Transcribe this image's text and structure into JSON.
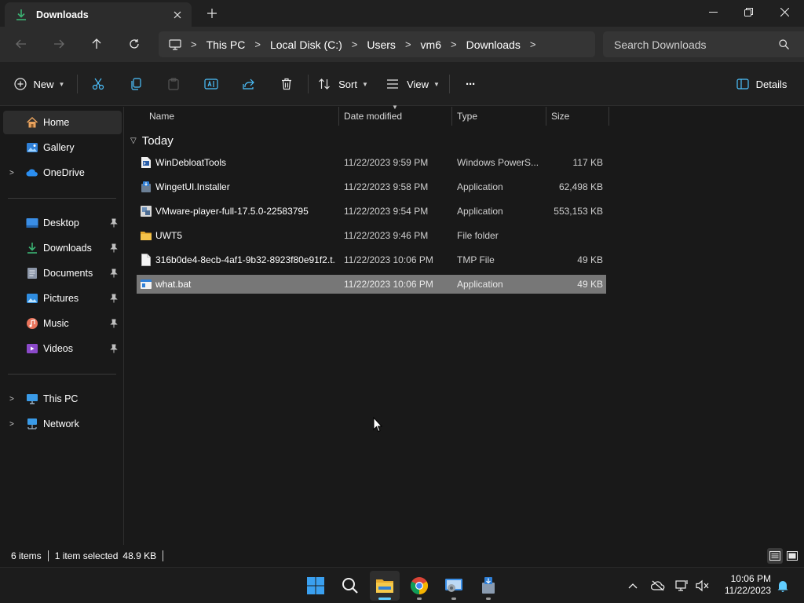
{
  "window": {
    "tab_title": "Downloads",
    "minimize_glyph": "—",
    "restore_glyph": "❐",
    "close_glyph": "✕"
  },
  "nav": {
    "breadcrumbs": [
      "This PC",
      "Local Disk (C:)",
      "Users",
      "vm6",
      "Downloads"
    ],
    "search_placeholder": "Search Downloads"
  },
  "commandbar": {
    "new_label": "New",
    "sort_label": "Sort",
    "view_label": "View",
    "more_label": "···",
    "details_label": "Details"
  },
  "sidebar": {
    "items": [
      {
        "label": "Home",
        "icon": "home-icon"
      },
      {
        "label": "Gallery",
        "icon": "gallery-icon"
      },
      {
        "label": "OneDrive",
        "icon": "onedrive-icon"
      },
      {
        "label": "Desktop",
        "icon": "desktop-icon"
      },
      {
        "label": "Downloads",
        "icon": "downloads-icon"
      },
      {
        "label": "Documents",
        "icon": "documents-icon"
      },
      {
        "label": "Pictures",
        "icon": "pictures-icon"
      },
      {
        "label": "Music",
        "icon": "music-icon"
      },
      {
        "label": "Videos",
        "icon": "videos-icon"
      },
      {
        "label": "This PC",
        "icon": "this-pc-icon"
      },
      {
        "label": "Network",
        "icon": "network-icon"
      }
    ]
  },
  "filelist": {
    "columns": {
      "name": "Name",
      "date": "Date modified",
      "type": "Type",
      "size": "Size"
    },
    "group_label": "Today",
    "rows": [
      {
        "name": "WinDebloatTools",
        "date": "11/22/2023 9:59 PM",
        "type": "Windows PowerS...",
        "size": "117 KB",
        "icon": "powershell-file-icon"
      },
      {
        "name": "WingetUI.Installer",
        "date": "11/22/2023 9:58 PM",
        "type": "Application",
        "size": "62,498 KB",
        "icon": "installer-icon"
      },
      {
        "name": "VMware-player-full-17.5.0-22583795",
        "date": "11/22/2023 9:54 PM",
        "type": "Application",
        "size": "553,153 KB",
        "icon": "vmware-installer-icon"
      },
      {
        "name": "UWT5",
        "date": "11/22/2023 9:46 PM",
        "type": "File folder",
        "size": "",
        "icon": "folder-icon"
      },
      {
        "name": "316b0de4-8ecb-4af1-9b32-8923f80e91f2.t...",
        "date": "11/22/2023 10:06 PM",
        "type": "TMP File",
        "size": "49 KB",
        "icon": "file-icon"
      },
      {
        "name": "what.bat",
        "date": "11/22/2023 10:06 PM",
        "type": "Application",
        "size": "49 KB",
        "icon": "batch-file-icon"
      }
    ]
  },
  "status": {
    "item_count": "6 items",
    "selection": "1 item selected",
    "selection_size": "48.9 KB"
  },
  "taskbar": {
    "time": "10:06 PM",
    "date": "11/22/2023"
  },
  "colors": {
    "accent": "#60cdff",
    "selected_row": "#777777",
    "folder": "#f3c24a"
  }
}
